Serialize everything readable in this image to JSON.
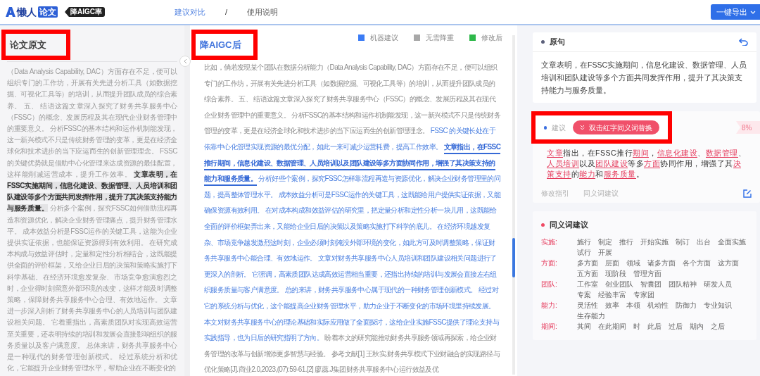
{
  "header": {
    "logo_text": "懒人",
    "logo_badge": "论文",
    "product_tag": "降AIGC率",
    "nav": [
      {
        "label": "建议对比",
        "selected": true
      },
      {
        "label": "使用说明",
        "selected": false
      }
    ],
    "nav_separator": "/",
    "export_button": "一键导出"
  },
  "original_panel": {
    "title": "论文原文",
    "segments": [
      {
        "text": "（Data Analysis Capability, DAC）方面存在不足，便可以组织专门的工作坊，开展有关先进分析工具（如数据挖掘、可视化工具等）的培训，从而提升团队成员的综合素养。 五、 结语这篇文章深入探究了财务共享服务中心（FSSC）的概念、发展历程及其在现代企业财务管理中的重要意义。 分析FSSC的基本结构和运作机制能发现，这一新兴模式不只是传统财务管理的变革，更是在经济全球化和技术进步的当下应运而生的创新管理理念。 FSSC的关键优势就是借助中心化管理来达成资源的最佳配置，这样能削减运营成本，提升工作效率。 ",
        "highlighted": false
      },
      {
        "text": "文章表明，在FSSC实施期间，信息化建设、数据管理、人员培训和团队建设等多个方面共同发挥作用，提升了其决策支持能力与服务质量。",
        "highlighted": true
      },
      {
        "text": " 分析多个案例，探究FSSC如何借助流程再造和资源优化，解决企业财务管理痛点，提升财务管理水平。 成本效益分析是FSSC运作的关键工具，这能为企业提供实证依据，也能保证资源得到有效利用。 在研究成本构成与效益评估时，定量和定性分析相结合，这既能提供全面的评价框架，又给企业日后的决策和策略实施打下科学基础。在经济环境愈发复杂、市场竞争愈演愈烈之时，企业得时刻留意外部环境的改变，这样才能及时调整策略，保障财务共享服务中心合理、有效地运作。 文章进一步深入剖析了财务共享服务中心的人员培训与团队建设相关问题。 它着重指出，高素质团队对实现高效运营至关重要，还表明持续的培训和发展会直接影响组织的服务质量以及客户满意度。 总体来讲，财务共享服务中心是一种现代的财务管理创新模式。 经过系统分析和优化，它能提升企业财务管理水平，帮助企业在不断变化的",
        "highlighted": false
      }
    ]
  },
  "revised_panel": {
    "title": "降AIGC后",
    "legend": [
      {
        "label": "机器建议",
        "color": "#3b7cf5"
      },
      {
        "label": "无需降重",
        "color": "#a8a8a8"
      },
      {
        "label": "修改后",
        "color": "#2eb84a"
      }
    ],
    "segments": [
      {
        "text": "比如，倘若发现某个团队在数据分析能力（Data Analysis Capability, DAC）方面存在不足，便可以组织专门的工作坊，开展有关先进分析工具（如数据挖掘、可视化工具等）的培训，从而提升团队成员的综合素养。 五、 结语这篇文章深入探究了财务共享服务中心（FSSC）的概念、发展历程及其在现代企业财务管理中的重要意义。 分析FSSC的基本结构和运作机制能发现，这一新兴模式不只是传统财务管理的变革，更是在经济全球化和技术进步的当下应运而生的创新管理理念。 ",
        "kind": "unchanged"
      },
      {
        "text": "FSSC 的关键长处在于依靠中心化管理实现资源的最优分配，如此一来可减少运营耗费，提高工作效率。 ",
        "kind": "suggested"
      },
      {
        "text": "文章指出，在FSSC推行期间，信息化建设、数据管理、人员培训以及团队建设等多方面协同作用，增强了其决策支持的能力和服务质量。",
        "kind": "selected"
      },
      {
        "text": " 分析好些个案例，探究FSSC怎样靠流程再造与资源优化，解决企业财务管理里的问题，提高整体管理水平。 成本效益分析可是FSSC运作的关键工具，这既能给用户提供实证依据，又能确保资源有效利用。 在对成本构成和效益评估的研究里，把定量分析和定性分析一块儿用，这既能给全面的评价框架弄出来，又能给企业日后的决策以及策略实施打下科学的底儿。 在经济环境越发复杂、市场竞争越发激烈这时刻，企业必须时刻淹没外部环境的变化，如此方可及时调整策略，保证财务共享服务中心能合理、有效地运作。 文章对财务共享服务中心人员培训和团队建设相关问题进行了更深入的剖析。 它强调，高素质团队达成高效运营相当重要，还指出持续的培训与发展会直接左右组织服务质量与客户满意度。 总的来讲，财务共享服务中心属于现代的一种财务管理创新模式。 经过对它的系统分析与优化，这个能提高企业财务管理水平，助力企业于不断变化的市场环境里持续发展。本文对财务共享服务中心的理论基础和实际应用做了全面探讨，这给企业实施FSSC提供了理论支持与实践指导，也为日后的研究指明了方向。 ",
        "kind": "suggested"
      },
      {
        "text": "盼着本文的研究能推动财务共享服务领域再探索，给企业财务管理的改革与创新增添更多智慧与经验。 参考文献[1] 王秋实.财务共享模式下业财融合的实现路径与优化策略[J].商业2.0,2023,(07):59-61.[2] 廖蕊.J集团财务共享服务中心运行效益及优",
        "kind": "unchanged"
      }
    ]
  },
  "sentence_card": {
    "title": "原句",
    "text": "文章表明，在FSSC实施期间，信息化建设、数据管理、人员培训和团队建设等多个方面共同发挥作用，提升了其决策支持能力与服务质量。"
  },
  "suggestion_card": {
    "title": "建议",
    "button": "双击红字同义词替换",
    "score": "8%",
    "segments": [
      {
        "text": "文章",
        "replaceable": true
      },
      {
        "text": "指出，在FSSC推行",
        "replaceable": false
      },
      {
        "text": "期间",
        "replaceable": true
      },
      {
        "text": "，",
        "replaceable": false
      },
      {
        "text": "信息化建设",
        "replaceable": true
      },
      {
        "text": "、",
        "replaceable": false
      },
      {
        "text": "数据管理",
        "replaceable": true
      },
      {
        "text": "、",
        "replaceable": false
      },
      {
        "text": "人员培训",
        "replaceable": true
      },
      {
        "text": "以及",
        "replaceable": false
      },
      {
        "text": "团队建设",
        "replaceable": true
      },
      {
        "text": "等多",
        "replaceable": false
      },
      {
        "text": "方面",
        "replaceable": true
      },
      {
        "text": "协同作用，增强了其",
        "replaceable": false
      },
      {
        "text": "决策支持",
        "replaceable": true
      },
      {
        "text": "的",
        "replaceable": false
      },
      {
        "text": "能力",
        "replaceable": true
      },
      {
        "text": "和",
        "replaceable": false
      },
      {
        "text": "服务质量",
        "replaceable": true
      },
      {
        "text": "。",
        "replaceable": false
      }
    ],
    "tabs": [
      "修改指引",
      "同义词建议"
    ]
  },
  "synonyms_card": {
    "title": "同义词建议",
    "groups": [
      {
        "term": "实施:",
        "words": [
          "施行",
          "制定",
          "推行",
          "开始实施",
          "制订",
          "出台",
          "全面实施",
          "试行",
          "开展"
        ]
      },
      {
        "term": "方面:",
        "words": [
          "多方面",
          "层面",
          "领域",
          "诸多方面",
          "各个方面",
          "这方面",
          "五方面",
          "现阶段",
          "管理方面"
        ]
      },
      {
        "term": "团队:",
        "words": [
          "工作室",
          "创业团队",
          "智囊团",
          "团队精神",
          "研发人员",
          "专案",
          "经验丰富",
          "专家团"
        ]
      },
      {
        "term": "能力:",
        "words": [
          "灵活性",
          "效率",
          "本领",
          "机动性",
          "防御力",
          "专业知识",
          "生存能力"
        ]
      },
      {
        "term": "期间:",
        "words": [
          "其间",
          "在此期间",
          "时",
          "此后",
          "过后",
          "期内",
          "之后"
        ]
      }
    ]
  }
}
